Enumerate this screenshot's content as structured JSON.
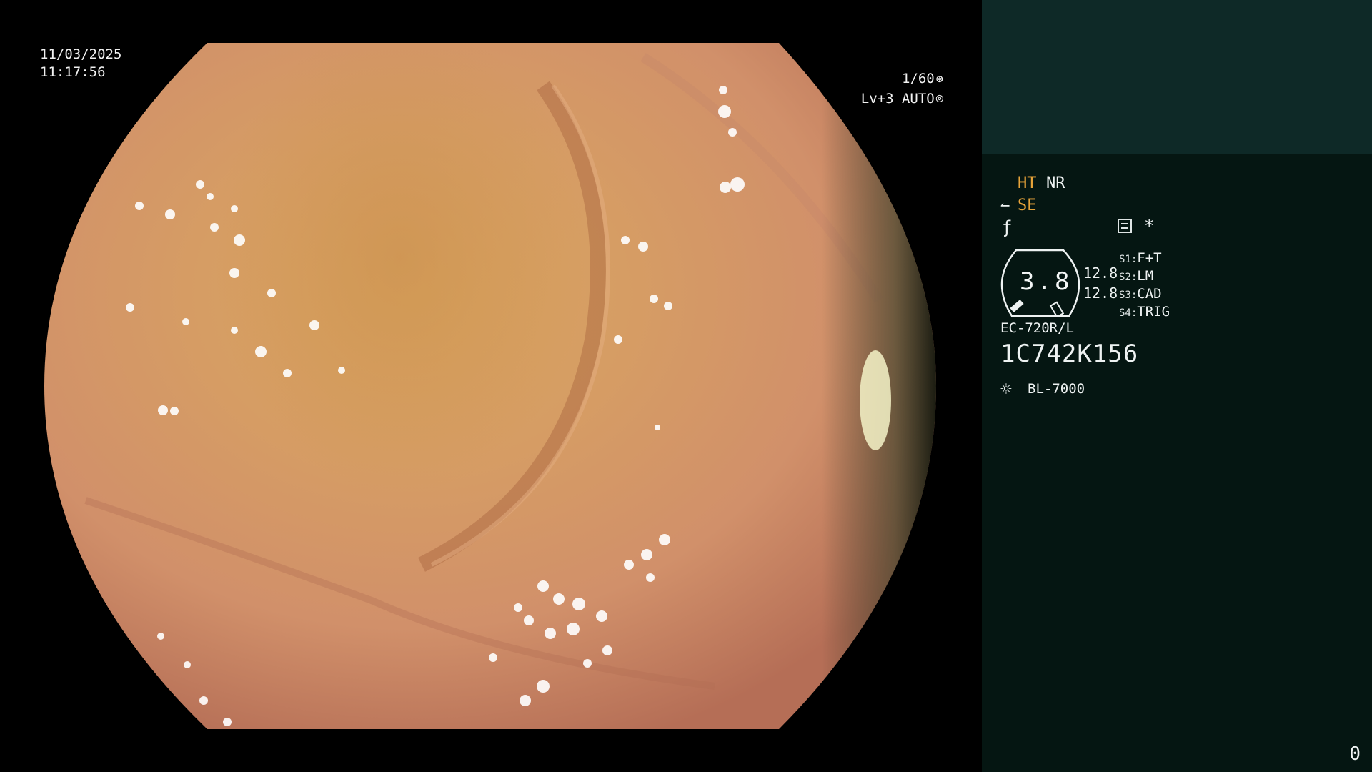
{
  "overlay": {
    "date": "11/03/2025",
    "time": "11:17:56",
    "shutter": "1/60",
    "shutter_icon": "aperture-icon",
    "level": "Lv+3 AUTO",
    "level_icon": "iris-icon"
  },
  "panel": {
    "ht": "HT",
    "nr": "NR",
    "se": "SE",
    "se_icon": "hooked-arrow-icon",
    "enhance_icon": "slashed-f-icon",
    "doc_icon": "menu-doc-icon",
    "asterisk": "*",
    "gauge_value": "3.8",
    "gauge_side_1": "12.8",
    "gauge_side_2": "12.8",
    "switches": [
      {
        "label": "S1:",
        "value": "F+T"
      },
      {
        "label": "S2:",
        "value": "LM"
      },
      {
        "label": "S3:",
        "value": "CAD"
      },
      {
        "label": "S4:",
        "value": "TRIG"
      }
    ],
    "scope_model": "EC-720R/L",
    "scope_serial": "1C742K156",
    "light_icon": "sun-icon",
    "light_source": "BL-7000",
    "counter": "0"
  },
  "colors": {
    "panel_bg": "#051612",
    "panel_top_bg": "#0e2927",
    "highlight": "#e8a43a",
    "text": "#eef2f2"
  }
}
